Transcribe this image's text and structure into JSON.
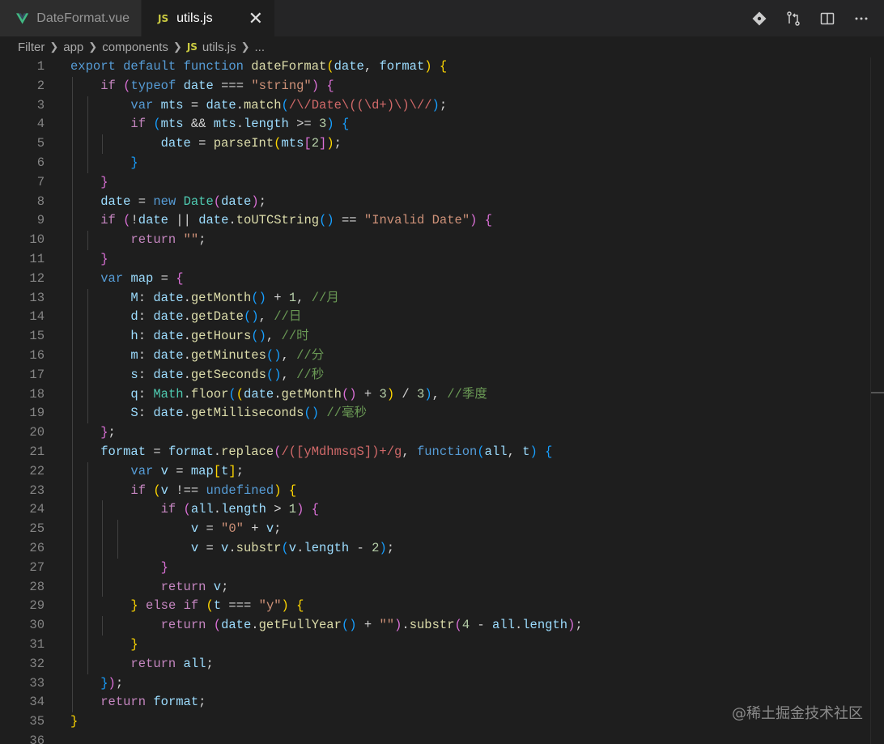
{
  "tabs": [
    {
      "label": "DateFormat.vue",
      "icon": "vue-icon",
      "active": false
    },
    {
      "label": "utils.js",
      "icon": "js-icon",
      "active": true
    }
  ],
  "tab_badge": "JS",
  "close_glyph": "✕",
  "breadcrumb": [
    "Filter",
    "app",
    "components",
    "utils.js",
    "..."
  ],
  "watermark": "@稀土掘金技术社区",
  "code_lines": [
    "export default function dateFormat(date, format) {",
    "  if (typeof date === \"string\") {",
    "    var mts = date.match(/\\/Date\\((\\d+)\\)\\//);",
    "    if (mts && mts.length >= 3) {",
    "      date = parseInt(mts[2]);",
    "    }",
    "  }",
    "  date = new Date(date);",
    "  if (!date || date.toUTCString() == \"Invalid Date\") {",
    "    return \"\";",
    "  }",
    "  var map = {",
    "    M: date.getMonth() + 1, //月",
    "    d: date.getDate(), //日",
    "    h: date.getHours(), //时",
    "    m: date.getMinutes(), //分",
    "    s: date.getSeconds(), //秒",
    "    q: Math.floor((date.getMonth() + 3) / 3), //季度",
    "    S: date.getMilliseconds() //毫秒",
    "  };",
    "  format = format.replace(/([yMdhmsqS])+/g, function(all, t) {",
    "    var v = map[t];",
    "    if (v !== undefined) {",
    "      if (all.length > 1) {",
    "        v = \"0\" + v;",
    "        v = v.substr(v.length - 2);",
    "      }",
    "      return v;",
    "    } else if (t === \"y\") {",
    "      return (date.getFullYear() + \"\").substr(4 - all.length);",
    "    }",
    "    return all;",
    "  });",
    "  return format;",
    "}",
    ""
  ]
}
